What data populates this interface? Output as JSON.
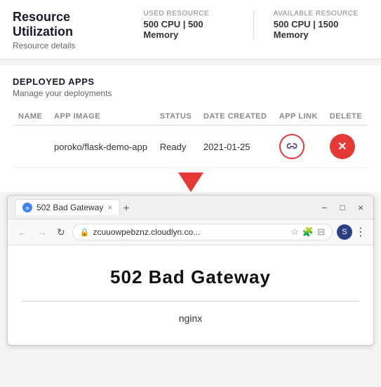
{
  "header": {
    "title": "Resource Utilization",
    "subtitle": "Resource details",
    "used_label": "USED RESOURCE",
    "used_value": "500 CPU | 500 Memory",
    "available_label": "AVAILABLE RESOURCE",
    "available_value": "500 CPU | 1500 Memory"
  },
  "deployed": {
    "title": "DEPLOYED APPS",
    "subtitle": "Manage your deployments",
    "table": {
      "columns": [
        "NAME",
        "APP IMAGE",
        "STATUS",
        "DATE CREATED",
        "APP LINK",
        "DELETE"
      ],
      "rows": [
        {
          "name": "",
          "app_image": "poroko/flask-demo-app",
          "status": "Ready",
          "date_created": "2021-01-25",
          "app_link": "link",
          "delete": "delete"
        }
      ]
    }
  },
  "browser": {
    "tab_title": "502 Bad Gateway",
    "tab_close": "×",
    "tab_new": "+",
    "nav_back": "←",
    "nav_forward": "→",
    "nav_refresh": "↻",
    "address": "zcuuowpebznz.cloudlyn.co...",
    "error_heading": "502 Bad Gateway",
    "error_server": "nginx",
    "win_minimize": "−",
    "win_maximize": "□",
    "win_close": "×"
  }
}
